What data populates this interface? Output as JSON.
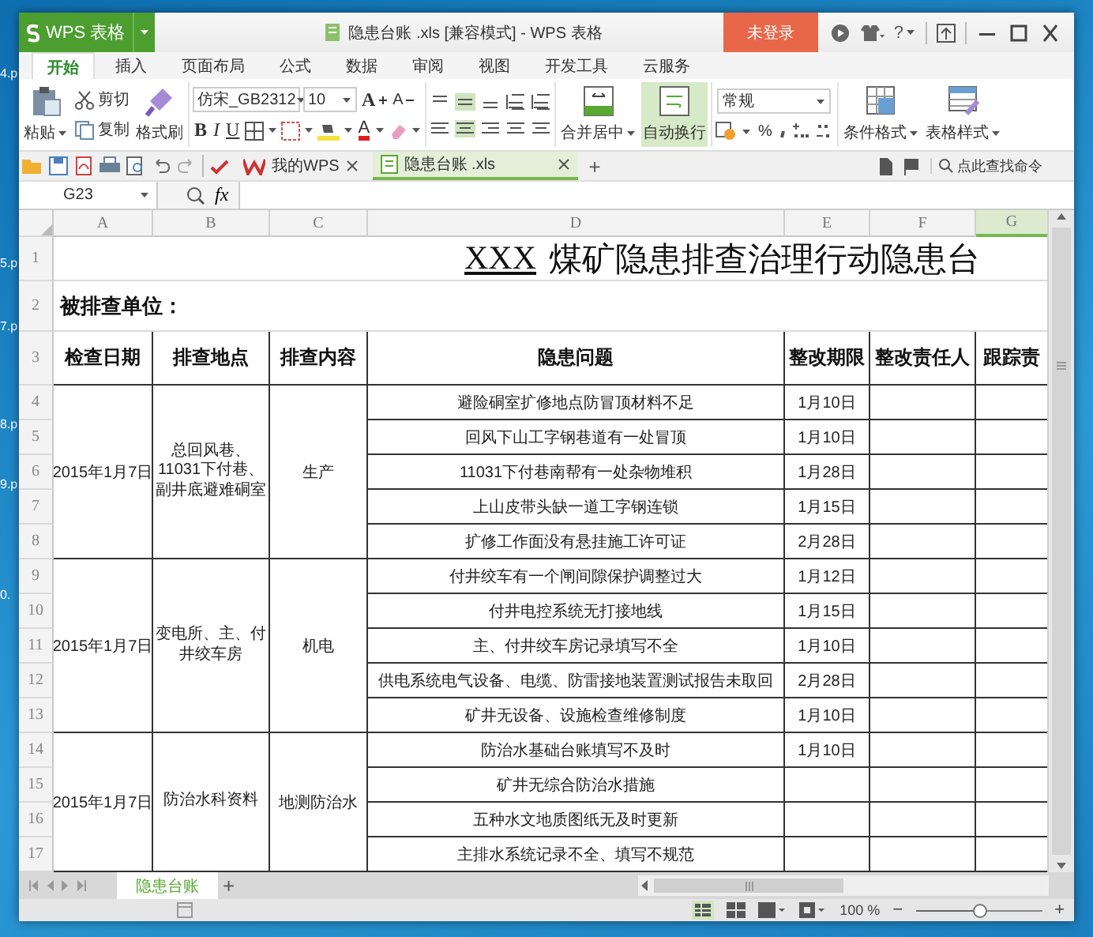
{
  "desktop": {
    "icon_labels": [
      "4.p",
      "5.p",
      "7.p",
      "8.p",
      "9.p",
      "0."
    ]
  },
  "app": {
    "name": "WPS 表格"
  },
  "window": {
    "title": "隐患台账 .xls [兼容模式] - WPS 表格",
    "login": "未登录",
    "help": "?"
  },
  "ribbon_tabs": [
    {
      "label": "开始",
      "selected": true
    },
    {
      "label": "插入",
      "selected": false
    },
    {
      "label": "页面布局",
      "selected": false
    },
    {
      "label": "公式",
      "selected": false
    },
    {
      "label": "数据",
      "selected": false
    },
    {
      "label": "审阅",
      "selected": false
    },
    {
      "label": "视图",
      "selected": false
    },
    {
      "label": "开发工具",
      "selected": false
    },
    {
      "label": "云服务",
      "selected": false
    }
  ],
  "ribbon": {
    "paste": "粘贴",
    "cut": "剪切",
    "copy": "复制",
    "format_painter": "格式刷",
    "font": "仿宋_GB2312",
    "size": "10",
    "grow": "A",
    "shrink": "A",
    "bold": "B",
    "italic": "I",
    "underline": "U",
    "font_color": "A",
    "merge": "合并居中",
    "wrap": {
      "label": "自动换行",
      "on": true
    },
    "number_format": "常规",
    "percent": "%",
    "conditional": "条件格式",
    "table_style": "表格样式"
  },
  "doc_tabs": [
    {
      "label": "我的WPS",
      "kind": "home",
      "selected": false
    },
    {
      "label": "隐患台账 .xls",
      "kind": "sheet",
      "selected": true
    }
  ],
  "new_tab": "+",
  "command_search": {
    "placeholder": "点此查找命令"
  },
  "formula_bar": {
    "name_box": "G23",
    "fx": "fx"
  },
  "columns": [
    {
      "label": "A",
      "selected": false
    },
    {
      "label": "B",
      "selected": false
    },
    {
      "label": "C",
      "selected": false
    },
    {
      "label": "D",
      "selected": false
    },
    {
      "label": "E",
      "selected": false
    },
    {
      "label": "F",
      "selected": false
    },
    {
      "label": "G",
      "selected": true
    }
  ],
  "row_numbers": [
    "1",
    "2",
    "3",
    "4",
    "5",
    "6",
    "7",
    "8",
    "9",
    "10",
    "11",
    "12",
    "13",
    "14",
    "15",
    "16",
    "17"
  ],
  "sheet": {
    "title_blank": "XXX",
    "title": "煤矿隐患排查治理行动隐患台",
    "unit_label": "被排查单位：",
    "headers": [
      "检查日期",
      "排查地点",
      "排查内容",
      "隐患问题",
      "整改期限",
      "整改责任人",
      "跟踪责"
    ],
    "groups": [
      {
        "date": "2015年1月7日",
        "location": [
          "总回风巷、",
          "11031下付巷、",
          "副井底避难硐室"
        ],
        "content": "生产",
        "items": [
          {
            "issue": "避险硐室扩修地点防冒顶材料不足",
            "deadline": "1月10日"
          },
          {
            "issue": "回风下山工字钢巷道有一处冒顶",
            "deadline": "1月10日"
          },
          {
            "issue": "11031下付巷南帮有一处杂物堆积",
            "deadline": "1月28日"
          },
          {
            "issue": "上山皮带头缺一道工字钢连锁",
            "deadline": "1月15日"
          },
          {
            "issue": "扩修工作面没有悬挂施工许可证",
            "deadline": "2月28日"
          }
        ]
      },
      {
        "date": "2015年1月7日",
        "location": [
          "变电所、主、付",
          "井绞车房"
        ],
        "content": "机电",
        "items": [
          {
            "issue": "付井绞车有一个闸间隙保护调整过大",
            "deadline": "1月12日"
          },
          {
            "issue": "付井电控系统无打接地线",
            "deadline": "1月15日"
          },
          {
            "issue": "主、付井绞车房记录填写不全",
            "deadline": "1月10日"
          },
          {
            "issue": "供电系统电气设备、电缆、防雷接地装置测试报告未取回",
            "deadline": "2月28日"
          },
          {
            "issue": "矿井无设备、设施检查维修制度",
            "deadline": "1月10日"
          }
        ]
      },
      {
        "date": "2015年1月7日",
        "location": [
          "防治水科资料"
        ],
        "content": "地测防治水",
        "items": [
          {
            "issue": "防治水基础台账填写不及时",
            "deadline": "1月10日"
          },
          {
            "issue": "矿井无综合防治水措施"
          },
          {
            "issue": "五种水文地质图纸无及时更新"
          },
          {
            "issue": "主排水系统记录不全、填写不规范"
          }
        ]
      }
    ]
  },
  "sheet_tabs": [
    {
      "label": "隐患台账",
      "selected": true
    }
  ],
  "add_sheet": "+",
  "zoom": {
    "label": "100 %",
    "minus": "−",
    "plus": "+",
    "level": 0.5
  }
}
